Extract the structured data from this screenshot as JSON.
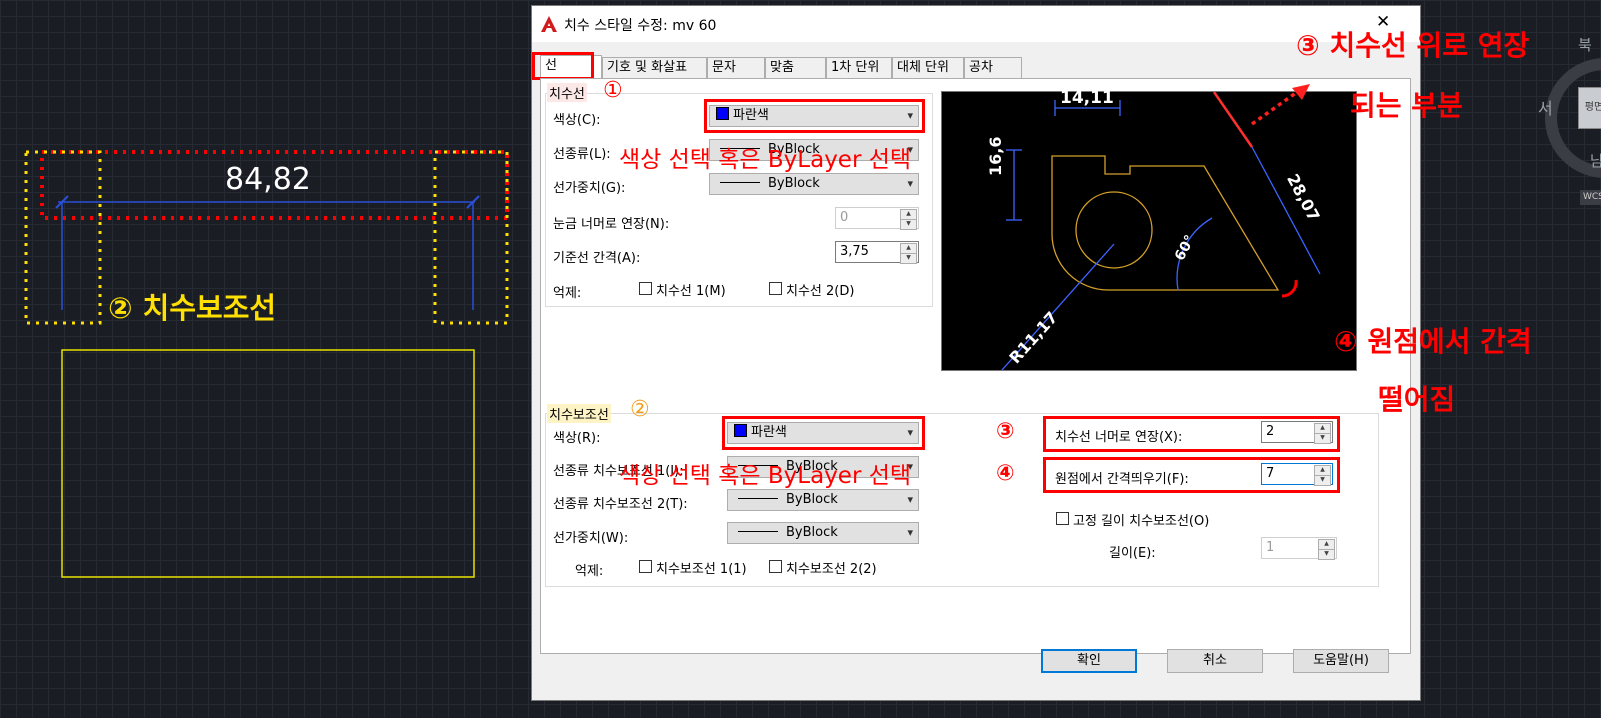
{
  "drawing": {
    "dim_value": "84,82",
    "ext_label": "② 치수보조선"
  },
  "dialog": {
    "title": "치수 스타일 수정: mv 60",
    "close": "✕",
    "tabs": [
      "선",
      "기호 및 화살표",
      "문자",
      "맞춤",
      "1차 단위",
      "대체 단위",
      "공차"
    ],
    "dimline": {
      "group_title": "치수선",
      "marker": "①",
      "color_label": "색상(C):",
      "color_value": "파란색",
      "linetype_label": "선종류(L):",
      "linetype_value": "ByBlock",
      "lineweight_label": "선가중치(G):",
      "lineweight_value": "ByBlock",
      "extend_ticks_label": "눈금 너머로 연장(N):",
      "extend_ticks_value": "0",
      "baseline_label": "기준선 간격(A):",
      "baseline_value": "3,75",
      "suppress_label": "억제:",
      "suppress_1": "치수선 1(M)",
      "suppress_2": "치수선 2(D)"
    },
    "extline": {
      "group_title": "치수보조선",
      "marker": "②",
      "color_label": "색상(R):",
      "color_value": "파란색",
      "linetype1_label": "선종류 치수보조선 1(I):",
      "linetype1_value": "ByBlock",
      "linetype2_label": "선종류 치수보조선 2(T):",
      "linetype2_value": "ByBlock",
      "lineweight_label": "선가중치(W):",
      "lineweight_value": "ByBlock",
      "suppress_label": "억제:",
      "suppress_1": "치수보조선 1(1)",
      "suppress_2": "치수보조선 2(2)",
      "extend_label": "치수선 너머로 연장(X):",
      "extend_value": "2",
      "offset_label": "원점에서 간격띄우기(F):",
      "offset_value": "7",
      "fixed_label": "고정 길이 치수보조선(O)",
      "length_label": "길이(E):",
      "length_value": "1"
    },
    "preview": {
      "dim_top": "14,11",
      "dim_left": "16,6",
      "dim_diag": "28,07",
      "dim_angle": "60°",
      "dim_radius": "R11,17"
    },
    "buttons": {
      "ok": "확인",
      "cancel": "취소",
      "help": "도움말(H)"
    }
  },
  "annotations": {
    "color_note": "색상 선택 혹은 ByLayer 선택",
    "note3_line1": "③  치수선 위로 연장",
    "note3_line2": "되는 부분",
    "note4_line1": "④ 원점에서 간격",
    "note4_line2": "떨어짐",
    "mark3": "③",
    "mark4": "④"
  },
  "viewcube": {
    "top": "북",
    "west": "서",
    "face": "평면",
    "bottom": "남",
    "wcs": "WCS"
  },
  "colors": {
    "accent_red": "#ff0000",
    "dim_blue": "#0000ff",
    "cad_yellow": "#ffe000",
    "preview_orange": "#d4a02a"
  }
}
